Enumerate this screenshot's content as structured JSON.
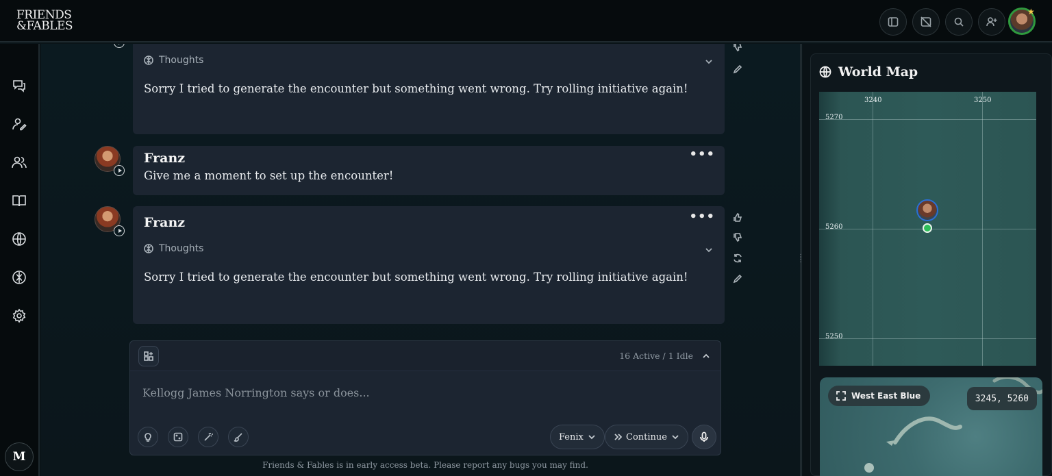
{
  "brand": {
    "line1": "FRIENDS",
    "line2": "&FABLES"
  },
  "topbar": {
    "buttons": [
      "sidebar-toggle-icon",
      "image-off-icon",
      "search-icon",
      "add-user-icon"
    ]
  },
  "sidebar": {
    "items": [
      "chat-icon",
      "character-icon",
      "party-icon",
      "book-icon",
      "globe-icon",
      "brain-icon",
      "settings-icon"
    ],
    "account_initial": "M"
  },
  "messages": [
    {
      "id": "m1",
      "name": "",
      "thoughts_label": "Thoughts",
      "text": "Sorry I tried to generate the encounter but something went wrong. Try rolling initiative again!"
    },
    {
      "id": "m2",
      "name": "Franz",
      "text": "Give me a moment to set up the encounter!"
    },
    {
      "id": "m3",
      "name": "Franz",
      "thoughts_label": "Thoughts",
      "text": "Sorry I tried to generate the encounter but something went wrong. Try rolling initiative again!"
    }
  ],
  "composer": {
    "status": "16 Active / 1 Idle",
    "placeholder": "Kellogg James Norrington says or does...",
    "model_label": "Fenix",
    "continue_label": "Continue"
  },
  "footer": "Friends & Fables is in early access beta. Please report any bugs you may find.",
  "world_map": {
    "title": "World Map",
    "x_ticks": [
      "3240",
      "3250"
    ],
    "y_ticks": [
      "5270",
      "5260",
      "5250"
    ],
    "region_name": "West East Blue",
    "coordinates": "3245, 5260"
  },
  "colors": {
    "accent_green": "#2fbf5a",
    "avatar_ring": "#2f9a3e",
    "star": "#f5c84c"
  }
}
